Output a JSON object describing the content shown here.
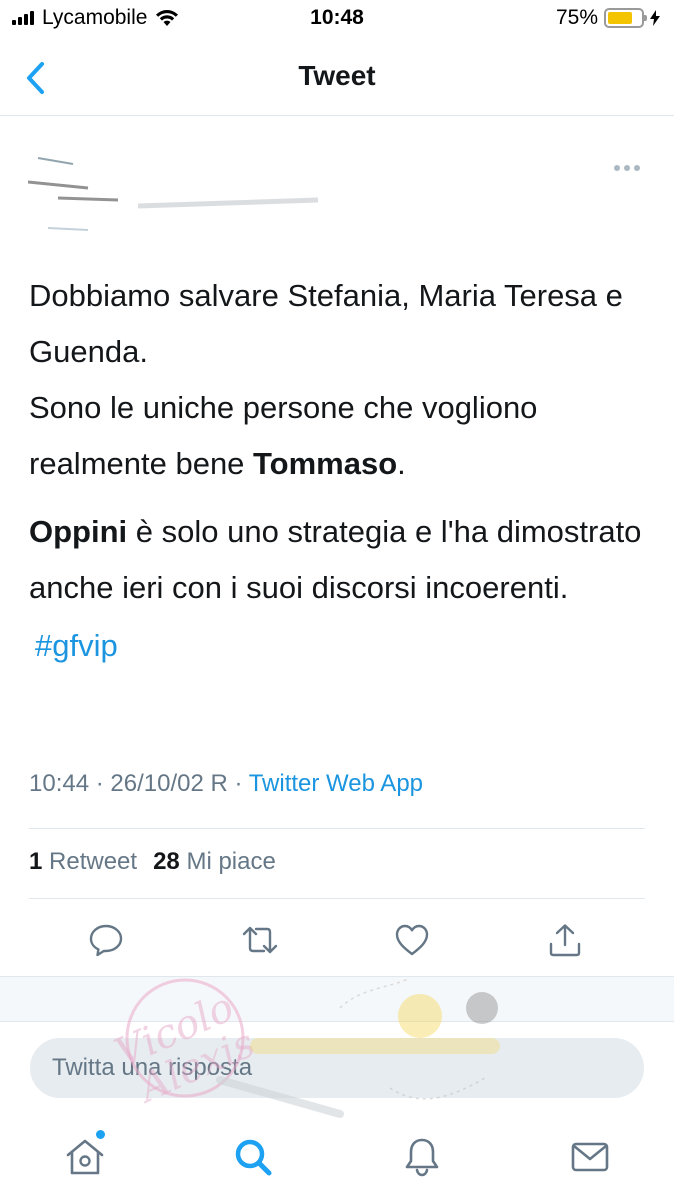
{
  "status_bar": {
    "carrier": "Lycamobile",
    "time": "10:48",
    "battery_percent": "75%",
    "battery_level": 0.75,
    "battery_color": "#f5c400",
    "icons": [
      "signal-icon",
      "wifi-icon",
      "battery-icon",
      "charging-bolt-icon"
    ]
  },
  "header": {
    "title": "Tweet",
    "back_icon": "chevron-left-icon"
  },
  "tweet": {
    "paragraph1_part1": "Dobbiamo salvare Stefania, Maria Teresa e Guenda.",
    "paragraph1_part2": "Sono le uniche persone che vogliono realmente bene ",
    "bold_name1": "Tommaso",
    "paragraph1_end": ".",
    "bold_name2": "Oppini",
    "paragraph2": " è solo uno strategia e l'ha dimostrato anche ieri con i suoi discorsi incoerenti.",
    "hashtag": "#gfvip",
    "timestamp": "10:44 · 26/10/02 R · ",
    "source_app": "Twitter Web App"
  },
  "stats": {
    "retweet_count": "1",
    "retweet_label": "Retweet",
    "likes_count": "28",
    "likes_label": "Mi piace"
  },
  "actions": [
    "reply-icon",
    "retweet-icon",
    "like-icon",
    "share-icon"
  ],
  "reply": {
    "placeholder": "Twitta una risposta"
  },
  "tabbar": {
    "items": [
      "home-icon",
      "search-icon",
      "notifications-icon",
      "messages-icon"
    ]
  },
  "colors": {
    "accent": "#1da1f2",
    "link": "#1b95e0",
    "secondary_text": "#657786"
  }
}
